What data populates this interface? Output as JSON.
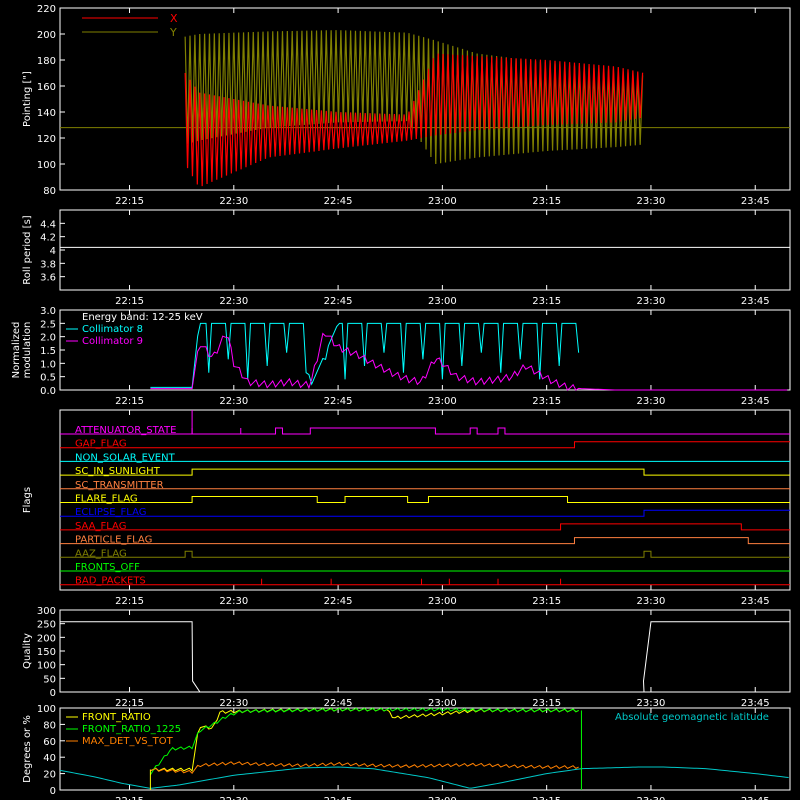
{
  "chart_data": [
    {
      "type": "line",
      "ylabel": "Pointing [\"]",
      "ylim": [
        80,
        220
      ],
      "yticks": [
        80,
        100,
        120,
        140,
        160,
        180,
        200,
        220
      ],
      "xlim": [
        "22:05",
        "23:50"
      ],
      "xticks": [
        "22:15",
        "22:30",
        "22:45",
        "23:00",
        "23:15",
        "23:30",
        "23:45"
      ],
      "legend_position": "top-left",
      "reference_line": 128,
      "series": [
        {
          "name": "X",
          "color": "#ff0000",
          "t": [
            "22:23",
            "22:25",
            "22:35",
            "22:45",
            "22:55",
            "22:59",
            "23:05",
            "23:15",
            "23:25",
            "23:29"
          ],
          "low": [
            100,
            82,
            105,
            112,
            118,
            122,
            126,
            130,
            132,
            136
          ],
          "high": [
            170,
            155,
            145,
            140,
            138,
            185,
            183,
            180,
            175,
            170
          ]
        },
        {
          "name": "Y",
          "color": "#808000",
          "t": [
            "22:23",
            "22:25",
            "22:35",
            "22:45",
            "22:55",
            "22:59",
            "23:05",
            "23:15",
            "23:25",
            "23:29"
          ],
          "low": [
            115,
            118,
            128,
            132,
            133,
            100,
            105,
            110,
            113,
            115
          ],
          "high": [
            198,
            200,
            202,
            203,
            201,
            195,
            185,
            178,
            172,
            168
          ]
        }
      ]
    },
    {
      "type": "line",
      "ylabel": "Roll period [s]",
      "ylim": [
        3.4,
        4.6
      ],
      "yticks": [
        3.6,
        3.8,
        4.0,
        4.2,
        4.4
      ],
      "xticks": [
        "22:15",
        "22:30",
        "22:45",
        "23:00",
        "23:15",
        "23:30",
        "23:45"
      ],
      "series": [
        {
          "name": "",
          "color": "#ffffff",
          "t": [
            "22:05",
            "23:50"
          ],
          "values": [
            4.04,
            4.04
          ]
        }
      ]
    },
    {
      "type": "line",
      "ylabel": [
        "Normalized",
        "modulation"
      ],
      "ylim": [
        0,
        3
      ],
      "yticks": [
        "0.0",
        "0.5",
        "1.0",
        "1.5",
        "2.0",
        "2.5",
        "3.0"
      ],
      "xticks": [
        "22:15",
        "22:30",
        "22:45",
        "23:00",
        "23:15",
        "23:30",
        "23:45"
      ],
      "annotation": "Energy band: 12-25 keV",
      "series": [
        {
          "name": "Collimator 8",
          "color": "#00ffff",
          "t": [
            "22:18",
            "22:24",
            "22:25",
            "22:27",
            "22:29",
            "22:32",
            "22:40",
            "22:41",
            "22:45",
            "22:55",
            "23:00",
            "23:10",
            "23:20"
          ],
          "values": [
            0.1,
            0.1,
            2.5,
            2.5,
            2.5,
            2.5,
            2.5,
            0.1,
            2.5,
            2.5,
            2.5,
            2.5,
            2.5
          ]
        },
        {
          "name": "Collimator 9",
          "color": "#ff00ff",
          "t": [
            "22:18",
            "22:24",
            "22:25",
            "22:27",
            "22:29",
            "22:30",
            "22:32",
            "22:35",
            "22:38",
            "22:40",
            "22:41",
            "22:43",
            "22:45",
            "22:48",
            "22:50",
            "22:53",
            "22:55",
            "22:57",
            "22:59",
            "23:00",
            "23:02",
            "23:05",
            "23:08",
            "23:10",
            "23:12",
            "23:14",
            "23:16",
            "23:18",
            "23:20",
            "23:25",
            "23:50"
          ],
          "values": [
            0.05,
            0.05,
            1.8,
            1.2,
            2.2,
            1.0,
            0.3,
            0.2,
            0.3,
            0.2,
            0.2,
            2.2,
            1.6,
            1.3,
            1.0,
            0.6,
            0.4,
            0.3,
            1.2,
            1.0,
            0.5,
            0.3,
            0.4,
            0.5,
            0.9,
            0.6,
            0.3,
            0.1,
            0.05,
            0.0,
            0.0
          ]
        }
      ]
    },
    {
      "type": "line",
      "ylabel": "Flags",
      "xticks": [
        "22:15",
        "22:30",
        "22:45",
        "23:00",
        "23:15",
        "23:30",
        "23:45"
      ],
      "flags": [
        {
          "name": "ATTENUATOR_STATE",
          "color": "#ff00ff",
          "steps": [
            [
              "22:24",
              1
            ],
            [
              "22:24",
              0
            ],
            [
              "22:31",
              1
            ],
            [
              "22:31",
              0
            ],
            [
              "22:36",
              1
            ],
            [
              "22:37",
              0
            ],
            [
              "22:41",
              1
            ],
            [
              "22:59",
              0
            ],
            [
              "23:04",
              1
            ],
            [
              "23:05",
              0
            ],
            [
              "23:08",
              1
            ],
            [
              "23:09",
              0
            ]
          ]
        },
        {
          "name": "GAP_FLAG",
          "color": "#ff0000",
          "steps": [
            [
              "23:19",
              1
            ]
          ]
        },
        {
          "name": "NON_SOLAR_EVENT",
          "color": "#00ffff",
          "steps": []
        },
        {
          "name": "SC_IN_SUNLIGHT",
          "color": "#ffff00",
          "steps": [
            [
              "22:24",
              1
            ],
            [
              "23:29",
              0
            ]
          ]
        },
        {
          "name": "SC_TRANSMITTER",
          "color": "#ff8040",
          "steps": []
        },
        {
          "name": "FLARE_FLAG",
          "color": "#ffff00",
          "steps": [
            [
              "22:24",
              1
            ],
            [
              "22:42",
              0
            ],
            [
              "22:46",
              1
            ],
            [
              "22:55",
              0
            ],
            [
              "22:58",
              1
            ],
            [
              "23:18",
              0
            ]
          ]
        },
        {
          "name": "ECLIPSE_FLAG",
          "color": "#0000ff",
          "steps": [
            [
              "22:24",
              0
            ],
            [
              "23:29",
              1
            ]
          ]
        },
        {
          "name": "SAA_FLAG",
          "color": "#ff0000",
          "steps": [
            [
              "23:17",
              1
            ],
            [
              "23:43",
              0
            ]
          ]
        },
        {
          "name": "PARTICLE_FLAG",
          "color": "#ff8040",
          "steps": [
            [
              "23:19",
              1
            ],
            [
              "23:44",
              0
            ]
          ]
        },
        {
          "name": "AAZ_FLAG",
          "color": "#808000",
          "steps": [
            [
              "22:23",
              1
            ],
            [
              "22:24",
              0
            ],
            [
              "23:29",
              1
            ],
            [
              "23:30",
              0
            ]
          ]
        },
        {
          "name": "FRONTS_OFF",
          "color": "#00ff00",
          "steps": []
        },
        {
          "name": "BAD_PACKETS",
          "color": "#ff0000",
          "spikes": [
            "22:34",
            "22:44",
            "22:57",
            "23:01",
            "23:08",
            "23:17"
          ]
        }
      ]
    },
    {
      "type": "line",
      "ylabel": "Quality",
      "ylim": [
        0,
        300
      ],
      "yticks": [
        0,
        50,
        100,
        150,
        200,
        250,
        300
      ],
      "xticks": [
        "22:15",
        "22:30",
        "22:45",
        "23:00",
        "23:15",
        "23:30",
        "23:45"
      ],
      "series": [
        {
          "name": "",
          "color": "#ffffff",
          "t": [
            "22:05",
            "22:24",
            "22:24",
            "22:25",
            "22:25",
            "23:29",
            "23:29",
            "23:30",
            "23:30",
            "23:50"
          ],
          "values": [
            257,
            257,
            40,
            2,
            0,
            0,
            40,
            257,
            257,
            257
          ]
        }
      ]
    },
    {
      "type": "line",
      "ylabel": "Degrees or %",
      "ylim": [
        0,
        100
      ],
      "yticks": [
        0,
        20,
        40,
        60,
        80,
        100
      ],
      "xticks": [
        "22:15",
        "22:30",
        "22:45",
        "23:00",
        "23:15",
        "23:30",
        "23:45"
      ],
      "annotation": "Absolute geomagnetic latitude",
      "series": [
        {
          "name": "FRONT_RATIO",
          "color": "#ffff00",
          "t": [
            "22:18",
            "22:24",
            "22:25",
            "22:27",
            "22:28",
            "22:35",
            "22:45",
            "22:52",
            "22:53",
            "23:05",
            "23:15",
            "23:20"
          ],
          "values": [
            25,
            25,
            78,
            75,
            95,
            97,
            98,
            98,
            88,
            97,
            97,
            97
          ]
        },
        {
          "name": "FRONT_RATIO_1225",
          "color": "#00ff00",
          "t": [
            "22:18",
            "22:21",
            "22:24",
            "22:25",
            "22:27",
            "22:29",
            "22:31",
            "22:45",
            "23:00",
            "23:10",
            "23:20"
          ],
          "values": [
            20,
            50,
            52,
            72,
            80,
            90,
            96,
            98,
            98,
            97,
            97
          ]
        },
        {
          "name": "MAX_DET_VS_TOT",
          "color": "#ff8000",
          "t": [
            "22:18",
            "22:24",
            "22:25",
            "22:30",
            "22:35",
            "22:40",
            "22:45",
            "22:50",
            "22:55",
            "23:00",
            "23:05",
            "23:10",
            "23:15",
            "23:20"
          ],
          "values": [
            25,
            22,
            30,
            33,
            31,
            30,
            32,
            30,
            29,
            30,
            31,
            29,
            28,
            28
          ]
        },
        {
          "name": "Absolute geomagnetic latitude",
          "color": "#00c8c8",
          "t": [
            "22:05",
            "22:10",
            "22:14",
            "22:18",
            "22:22",
            "22:30",
            "22:40",
            "22:45",
            "22:50",
            "22:58",
            "23:04",
            "23:08",
            "23:15",
            "23:20",
            "23:28",
            "23:32",
            "23:38",
            "23:45",
            "23:50"
          ],
          "values": [
            24,
            16,
            8,
            2,
            6,
            18,
            27,
            28,
            26,
            15,
            2,
            8,
            20,
            26,
            28,
            28,
            26,
            20,
            15
          ]
        }
      ]
    }
  ]
}
